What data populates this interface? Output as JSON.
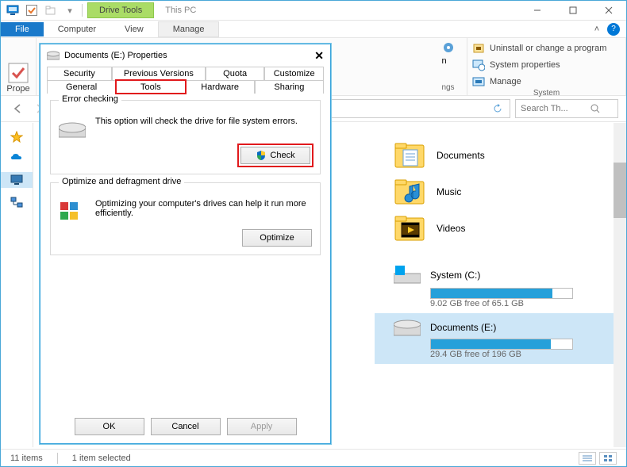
{
  "titlebar": {
    "drive_tools": "Drive Tools",
    "this_pc": "This PC"
  },
  "ribbon": {
    "file": "File",
    "computer": "Computer",
    "view": "View",
    "manage": "Manage"
  },
  "ribbon_body": {
    "properties": "Prope",
    "ngs": "ngs",
    "n": "n",
    "uninstall": "Uninstall or change a program",
    "sys_props": "System properties",
    "manage": "Manage",
    "group_system": "System"
  },
  "navbar": {
    "search_placeholder": "Search Th..."
  },
  "folders": [
    {
      "label": "Documents"
    },
    {
      "label": "Music"
    },
    {
      "label": "Videos"
    }
  ],
  "drives": [
    {
      "name": "System (C:)",
      "free": "9.02 GB free of 65.1 GB",
      "fill": 86,
      "icon": "windows"
    },
    {
      "name": "Documents (E:)",
      "free": "29.4 GB free of 196 GB",
      "fill": 85,
      "icon": "disk"
    }
  ],
  "statusbar": {
    "items": "11 items",
    "selected": "1 item selected"
  },
  "dialog": {
    "title": "Documents (E:) Properties",
    "tabs_row1": [
      "Security",
      "Previous Versions",
      "Quota",
      "Customize"
    ],
    "tabs_row2": [
      "General",
      "Tools",
      "Hardware",
      "Sharing"
    ],
    "active_tab": "Tools",
    "error_checking": {
      "legend": "Error checking",
      "desc": "This option will check the drive for file system errors.",
      "button": "Check"
    },
    "optimize": {
      "legend": "Optimize and defragment drive",
      "desc": "Optimizing your computer's drives can help it run more efficiently.",
      "button": "Optimize"
    },
    "buttons": {
      "ok": "OK",
      "cancel": "Cancel",
      "apply": "Apply"
    }
  }
}
